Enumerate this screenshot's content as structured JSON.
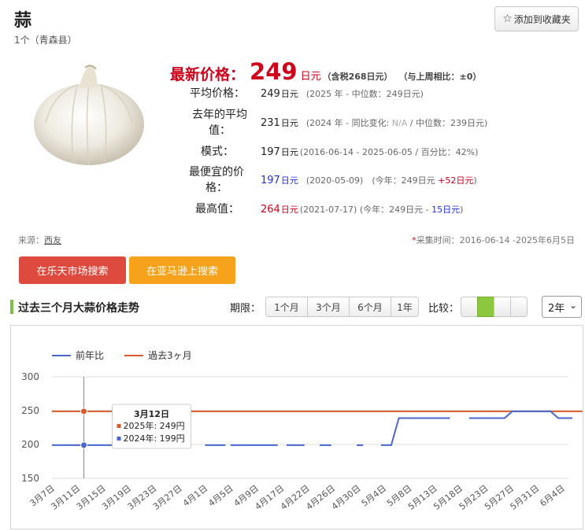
{
  "product": {
    "title": "蒜",
    "subtitle": "1个（青森县）",
    "favorite_label": "添加到收藏夹",
    "image_alt_icon": "garlic-image"
  },
  "price": {
    "latest_label": "最新价格：",
    "latest_value": "249",
    "latest_unit": "日元",
    "tax_note": "（含税268日元）",
    "weekly_note": "（与上周相比：±0）",
    "rows": {
      "avg": {
        "label": "平均价格：",
        "value": "249",
        "unit": "日元",
        "note": "(2025 年 - 中位数：249日元)"
      },
      "last_year": {
        "label": "去年的平均值：",
        "value": "231",
        "unit": "日元",
        "note_pre": "(2024 年 - 同比变化: ",
        "note_na": "N/A",
        "note_post": " / 中位数：239日元)"
      },
      "mode": {
        "label": "模式：",
        "value": "197",
        "unit": "日元",
        "note": "(2016-06-14 - 2025-06-05 / 百分比：42%)"
      },
      "cheapest": {
        "label": "最便宜的价格：",
        "value": "197",
        "unit": "日元",
        "note_pre": "(2020-05-09)　(今年：249日元 ",
        "note_diff": "+52日元",
        "note_post": ")"
      },
      "highest": {
        "label": "最高值：",
        "value": "264",
        "unit": "日元",
        "note_pre": "(2021-07-17) (今年：249日元 - ",
        "note_diff": "15日元",
        "note_post": ")"
      }
    }
  },
  "meta": {
    "source_label": "来源：",
    "source_link": "西友",
    "collect_ast": "*",
    "collect_text": "采集时间：2016-06-14 -2025年6月5日"
  },
  "actions": {
    "rakuten": "在乐天市场搜索",
    "amazon": "在亚马逊上搜索"
  },
  "trend": {
    "title": "过去三个月大蒜价格走势",
    "period_label": "期限：",
    "periods": [
      "1个月",
      "3个月",
      "6个月",
      "1年"
    ],
    "compare_label": "比较：",
    "year_value": "2年"
  },
  "chart_data": {
    "type": "line",
    "legend": [
      {
        "name": "前年比",
        "color": "#4a67cf"
      },
      {
        "name": "過去3ヶ月",
        "color": "#d95a2a"
      }
    ],
    "ylim": [
      150,
      300
    ],
    "yticks": [
      "300",
      "250",
      "200",
      "150"
    ],
    "xticks": [
      "3月7日",
      "3月11日",
      "3月15日",
      "3月19日",
      "3月23日",
      "3月27日",
      "4月1日",
      "4月5日",
      "4月9日",
      "4月17日",
      "4月22日",
      "4月26日",
      "4月30日",
      "5月4日",
      "5月8日",
      "5月13日",
      "5月18日",
      "5月23日",
      "5月27日",
      "5月31日",
      "6月4日"
    ],
    "series": [
      {
        "name": "過去3ヶ月",
        "color": "#d95a2a",
        "segments": [
          [
            [
              0,
              249
            ],
            [
              20.8,
              249
            ]
          ]
        ]
      },
      {
        "name": "前年比",
        "color": "#4a67cf",
        "segments": [
          [
            [
              0,
              199
            ],
            [
              2.4,
              199
            ]
          ],
          [
            [
              6.0,
              199
            ],
            [
              6.8,
              199
            ]
          ],
          [
            [
              7.0,
              199
            ],
            [
              8.85,
              199
            ]
          ],
          [
            [
              9.2,
              199
            ],
            [
              9.9,
              199
            ]
          ],
          [
            [
              10.5,
              199
            ],
            [
              10.95,
              199
            ]
          ],
          [
            [
              11.95,
              199
            ],
            [
              12.2,
              199
            ]
          ],
          [
            [
              12.9,
              199
            ],
            [
              13.3,
              199
            ],
            [
              13.6,
              239
            ],
            [
              15.6,
              239
            ]
          ],
          [
            [
              16.35,
              239
            ],
            [
              17.75,
              239
            ],
            [
              18.05,
              249
            ],
            [
              19.55,
              249
            ],
            [
              19.85,
              239
            ],
            [
              20.4,
              239
            ]
          ]
        ]
      }
    ],
    "tooltip": {
      "date": "3月12日",
      "line1": "2025年: 249円",
      "line2": "2024年: 199円",
      "x_index": 1.25
    }
  }
}
